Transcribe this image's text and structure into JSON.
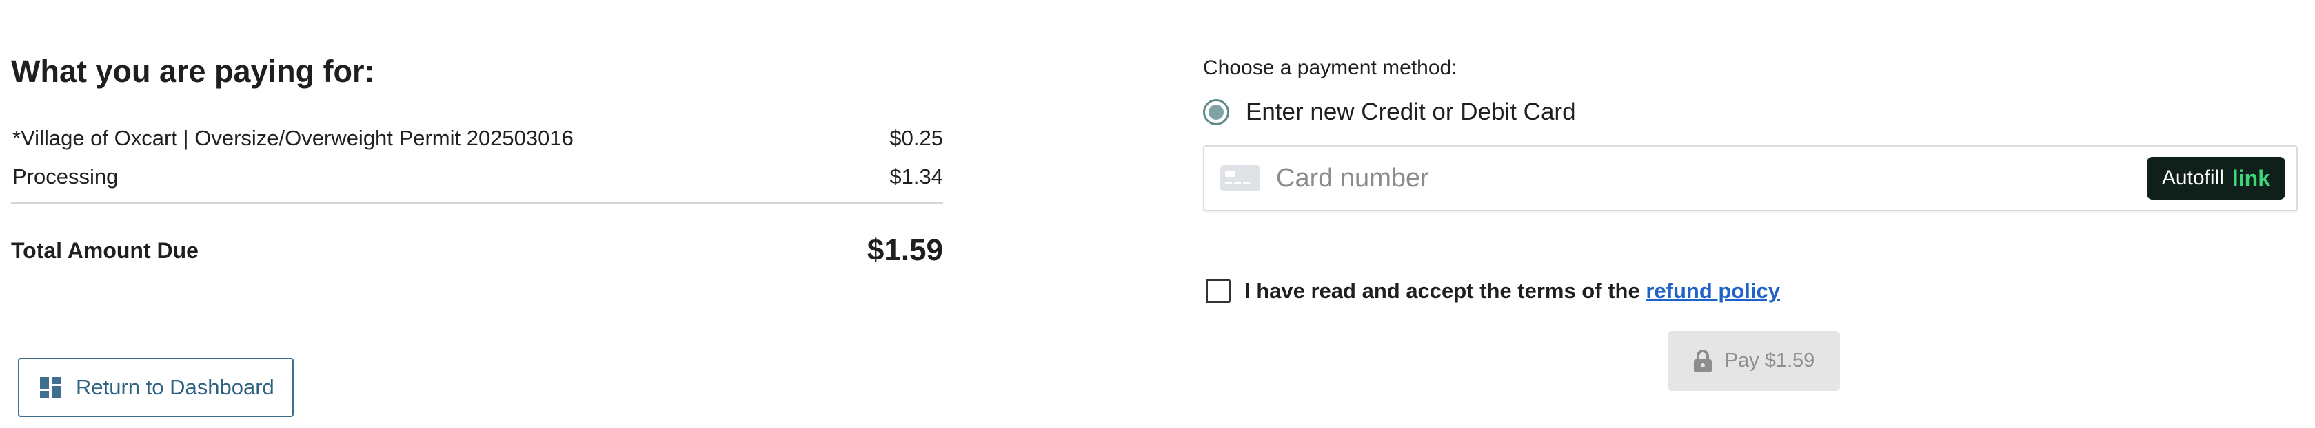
{
  "summary": {
    "title": "What you are paying for:",
    "items": [
      {
        "label": "*Village of Oxcart | Oversize/Overweight Permit 202503016",
        "amount": "$0.25"
      },
      {
        "label": "Processing",
        "amount": "$1.34"
      }
    ],
    "total_label": "Total Amount Due",
    "total_amount": "$1.59",
    "return_button": {
      "label": "Return to Dashboard",
      "icon": "dashboard-icon"
    }
  },
  "payment": {
    "method_title": "Choose a payment method:",
    "methods": [
      {
        "label": "Enter new Credit or Debit Card",
        "selected": true
      }
    ],
    "card_field": {
      "placeholder": "Card number",
      "value": "",
      "icon": "credit-card-icon",
      "autofill_label": "Autofill",
      "autofill_brand": "link"
    },
    "terms": {
      "text": "I have read and accept the terms of the",
      "link_text": "refund policy",
      "checked": false
    },
    "pay_button": {
      "label": "Pay $1.59",
      "icon": "lock-icon",
      "enabled": false
    }
  },
  "colors": {
    "text": "#1f1f1f",
    "return_border": "#3f6f8f",
    "radio_accent": "#5f8a8a",
    "link": "#1f63c8",
    "autofill_bg": "#0f1f1a",
    "autofill_brand": "#40d67a",
    "pay_disabled_bg": "#e5e5e5",
    "pay_disabled_text": "#8d8d8d"
  }
}
